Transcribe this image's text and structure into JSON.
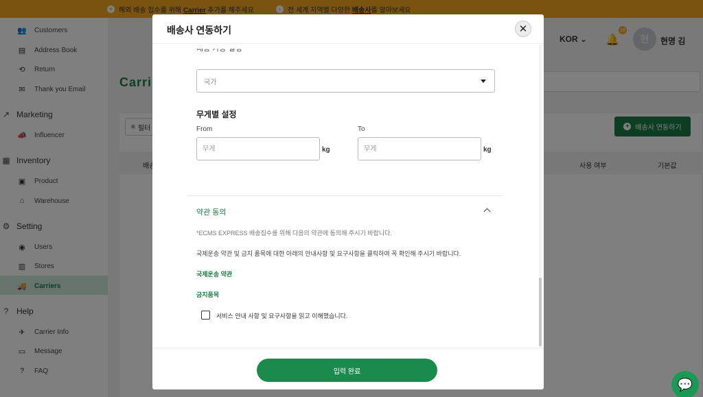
{
  "topbar": {
    "notice1": {
      "icon": "plus-circle-icon",
      "before": "해외 배송 집수를 위해 ",
      "link": "Carrier",
      "after": " 추가를 해주세요"
    },
    "notice2": {
      "icon": "chevron-right-circle-icon",
      "before": "전 세계 지역별 다양한 ",
      "link": "배송사",
      "after": "를 알아보세요"
    },
    "bg_color": "#f5a623"
  },
  "sidebar": {
    "items": [
      {
        "label": "Customers",
        "icon": "users-icon"
      },
      {
        "label": "Address Book",
        "icon": "address-book-icon"
      },
      {
        "label": "Return",
        "icon": "return-icon"
      },
      {
        "label": "Thank you Email",
        "icon": "email-icon"
      }
    ],
    "groups": [
      {
        "label": "Marketing",
        "icon": "trend-icon",
        "items": [
          {
            "label": "Influencer",
            "icon": "megaphone-icon"
          }
        ]
      },
      {
        "label": "Inventory",
        "icon": "inventory-icon",
        "items": [
          {
            "label": "Product",
            "icon": "box-icon"
          },
          {
            "label": "Warehouse",
            "icon": "warehouse-icon"
          }
        ]
      },
      {
        "label": "Setting",
        "icon": "gear-icon",
        "items": [
          {
            "label": "Users",
            "icon": "user-circle-icon"
          },
          {
            "label": "Stores",
            "icon": "store-icon"
          },
          {
            "label": "Carriers",
            "icon": "truck-icon"
          }
        ]
      },
      {
        "label": "Help",
        "icon": "help-icon",
        "items": [
          {
            "label": "Carrier Info",
            "icon": "plane-icon"
          },
          {
            "label": "Message",
            "icon": "message-icon"
          },
          {
            "label": "FAQ",
            "icon": "faq-icon"
          }
        ]
      }
    ],
    "active_item": "Carriers"
  },
  "header": {
    "lang": "KOR",
    "notification_count": "18",
    "avatar_initial": "현",
    "username": "현명 김"
  },
  "main": {
    "page_title": "Carri",
    "filter_label": "필터",
    "add_button_label": "배송사 연동하기",
    "columns": {
      "col1": "배송",
      "col_use": "사용 여부",
      "col_default": "기본값"
    }
  },
  "modal": {
    "title": "배송사 연동하기",
    "cut_label": "배송 가능 설정",
    "country_placeholder": "국가",
    "weight_section_title": "무게별 설정",
    "from_label": "From",
    "to_label": "To",
    "weight_placeholder": "무게",
    "unit": "kg",
    "terms_title": "약관 동의",
    "terms_intro": "*ECMS EXPRESS 배송집수를 위해 다음의 약관에 동의해 주시기 바랍니다.",
    "terms_notice": "국제운송 약관 및 금지 품목에 대한 아래의 안내사항 및 요구사항을 클릭하여 꼭 확인해 주시기 바랍니다.",
    "link_terms": "국제운송 약관",
    "link_prohibited": "금지품목",
    "agree_text": "서비스 안내 사항 및 요구사항을 읽고 이해했습니다.",
    "submit_label": "입력 완료"
  },
  "colors": {
    "accent": "#1a7a44",
    "button": "#1a8b4c"
  }
}
